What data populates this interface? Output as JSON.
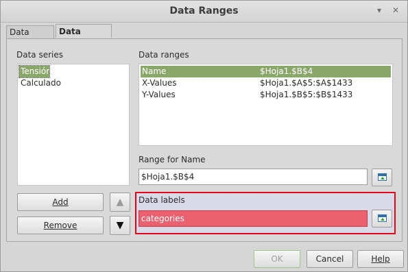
{
  "window": {
    "title": "Data Ranges"
  },
  "tabs": [
    {
      "label": "Data Range",
      "active": false
    },
    {
      "label": "Data Series",
      "active": true
    }
  ],
  "data_series": {
    "label": "Data series",
    "items": [
      "Tensión",
      "Calculado"
    ],
    "selected": "Tensión"
  },
  "data_ranges": {
    "label": "Data ranges",
    "rows": [
      {
        "name": "Name",
        "range": "$Hoja1.$B$4",
        "selected": true
      },
      {
        "name": "X-Values",
        "range": "$Hoja1.$A$5:$A$1433",
        "selected": false
      },
      {
        "name": "Y-Values",
        "range": "$Hoja1.$B$5:$B$1433",
        "selected": false
      }
    ]
  },
  "range_for_name": {
    "label": "Range for Name",
    "value": "$Hoja1.$B$4"
  },
  "data_labels": {
    "label": "Data labels",
    "value": "categories",
    "highlight_color": "#ec6170"
  },
  "buttons": {
    "add": "Add",
    "remove": "Remove",
    "ok": "OK",
    "cancel": "Cancel",
    "help": "Help",
    "move_up": "▲",
    "move_down": "▼"
  },
  "accent": {
    "selection": "#8aa76a",
    "annotation_border": "#e0001a"
  }
}
